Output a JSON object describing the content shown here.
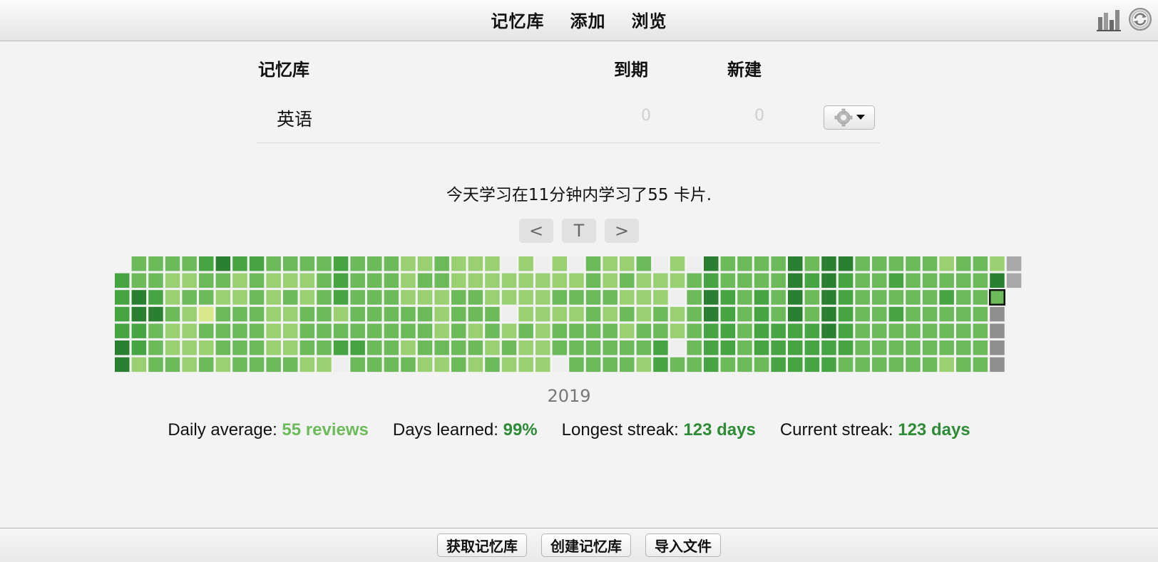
{
  "topbar": {
    "nav": [
      "记忆库",
      "添加",
      "浏览"
    ],
    "icons": [
      "stats-icon",
      "sync-icon"
    ]
  },
  "deck_table": {
    "headers": {
      "deck": "记忆库",
      "due": "到期",
      "new": "新建"
    },
    "rows": [
      {
        "name": "英语",
        "due": "0",
        "new": "0"
      }
    ]
  },
  "summary": "今天学习在11分钟内学习了55 卡片.",
  "heatmap_nav": {
    "prev": "<",
    "today": "T",
    "next": ">"
  },
  "heatmap": {
    "year": "2019",
    "weeks": 54,
    "days_per_week": 7,
    "levels": [
      "X3333442",
      "224433144",
      "2234222222",
      "2112112112",
      "2121111211",
      "3221212122",
      "4212221114",
      "3112222222",
      "3222222332",
      "2111112232",
      "2121112223",
      "2112221121",
      "2222221221",
      "3331234330",
      "2222232222",
      "2222222222",
      "2222222222",
      "1112212120",
      "1212221222",
      "2211121122",
      "1122222112",
      "1122121222",
      "1112212222",
      "0110121222",
      "1111211210",
      "0111111121",
      "1121222212",
      "0121222222",
      "2222222222",
      "1121222222",
      "1212122221",
      "2111221223",
      "0112233332",
      "1101122222",
      "0222222223",
      "4344333333",
      "2233332223",
      "2222222222",
      "2233332222",
      "2222333222",
      "4444333333",
      "2322333343",
      "4444433333",
      "4333332232",
      "2222222222",
      "2222222222",
      "2323222222",
      "2222222222",
      "2222222222",
      "1232221223",
      "GGgggggg",
      "gg"
    ],
    "colors": {
      "0": "#eeeeee",
      "1": "#9ad071",
      "2": "#6dba5b",
      "3": "#46a443",
      "4": "#2a7f31",
      "pale": "#d9e88a",
      "future": "#a8a8a8",
      "future_dark": "#8f8f8f",
      "today_border": "#111111"
    }
  },
  "stats": {
    "daily_average_label": "Daily average: ",
    "daily_average_value": "55 reviews",
    "days_learned_label": "Days learned: ",
    "days_learned_value": "99%",
    "longest_streak_label": "Longest streak: ",
    "longest_streak_value": "123 days",
    "current_streak_label": "Current streak: ",
    "current_streak_value": "123 days"
  },
  "bottombar": {
    "get_shared": "获取记忆库",
    "create_deck": "创建记忆库",
    "import_file": "导入文件"
  }
}
